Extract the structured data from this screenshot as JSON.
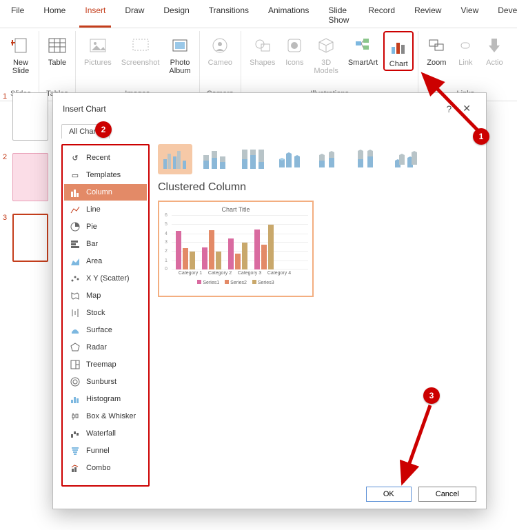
{
  "ribbon_tabs": [
    "File",
    "Home",
    "Insert",
    "Draw",
    "Design",
    "Transitions",
    "Animations",
    "Slide Show",
    "Record",
    "Review",
    "View",
    "Develo"
  ],
  "active_tab": "Insert",
  "ribbon_groups": {
    "slides": {
      "label": "Slides",
      "new_slide": "New\nSlide"
    },
    "tables": {
      "label": "Tables",
      "table": "Table"
    },
    "images": {
      "label": "Images",
      "pictures": "Pictures",
      "screenshot": "Screenshot",
      "photo_album": "Photo\nAlbum"
    },
    "camera": {
      "label": "Camera",
      "cameo": "Cameo"
    },
    "illustrations": {
      "label": "Illustrations",
      "shapes": "Shapes",
      "icons": "Icons",
      "models": "3D\nModels",
      "smartart": "SmartArt",
      "chart": "Chart"
    },
    "links": {
      "label": "Links",
      "zoom": "Zoom",
      "link": "Link",
      "action": "Actio"
    }
  },
  "dialog": {
    "title": "Insert Chart",
    "tab": "All Charts",
    "chart_types": [
      "Recent",
      "Templates",
      "Column",
      "Line",
      "Pie",
      "Bar",
      "Area",
      "X Y (Scatter)",
      "Map",
      "Stock",
      "Surface",
      "Radar",
      "Treemap",
      "Sunburst",
      "Histogram",
      "Box & Whisker",
      "Waterfall",
      "Funnel",
      "Combo"
    ],
    "selected_type": "Column",
    "subtitle": "Clustered Column",
    "preview": {
      "title": "Chart Title",
      "categories": [
        "Category 1",
        "Category 2",
        "Category 3",
        "Category 4"
      ],
      "series": [
        "Series1",
        "Series2",
        "Series3"
      ]
    },
    "ok": "OK",
    "cancel": "Cancel"
  },
  "callouts": {
    "c1": "1",
    "c2": "2",
    "c3": "3"
  },
  "slides": [
    "1",
    "2",
    "3"
  ],
  "chart_data": {
    "type": "bar",
    "title": "Chart Title",
    "categories": [
      "Category 1",
      "Category 2",
      "Category 3",
      "Category 4"
    ],
    "series": [
      {
        "name": "Series1",
        "values": [
          4.3,
          2.5,
          3.5,
          4.5
        ]
      },
      {
        "name": "Series2",
        "values": [
          2.4,
          4.4,
          1.8,
          2.8
        ]
      },
      {
        "name": "Series3",
        "values": [
          2.0,
          2.0,
          3.0,
          5.0
        ]
      }
    ],
    "ylim": [
      0,
      6
    ],
    "xlabel": "",
    "ylabel": ""
  }
}
